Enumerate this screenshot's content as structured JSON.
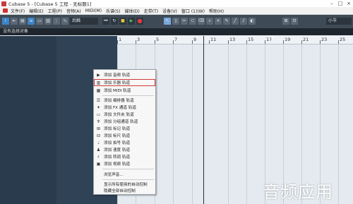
{
  "window": {
    "title": "Cubase 5 - [Cubase 5 工程 - 无标题1]",
    "controls": [
      "–",
      "□",
      "×"
    ]
  },
  "menubar": {
    "items": [
      "文件(F)",
      "编辑(E)",
      "工程(P)",
      "音频(A)",
      "MIDI(M)",
      "乐谱(S)",
      "媒体(D)",
      "走带(T)",
      "设备(V)",
      "窗口 (1)(W)",
      "帮助(H)"
    ]
  },
  "toolbar": {
    "mode_text": "后触",
    "snap_text": "小节"
  },
  "status": {
    "text": "没有选择对象"
  },
  "ruler": {
    "labels": [
      "1",
      "3",
      "5",
      "7",
      "9",
      "11",
      "13",
      "15",
      "17",
      "19",
      "21",
      "23",
      "25"
    ]
  },
  "context_menu": {
    "items": [
      {
        "label": "添加 音频 轨道",
        "icon": "play-icon"
      },
      {
        "label": "添加 乐器 轨道",
        "icon": "instrument-icon",
        "highlighted": true
      },
      {
        "label": "添加 MIDI 轨道",
        "icon": "midi-icon"
      },
      {
        "label": "添加 编排器 轨道",
        "icon": "arranger-icon"
      },
      {
        "label": "添加 FX 通道 轨道",
        "icon": "fx-icon"
      },
      {
        "label": "添加 文件夹 轨道",
        "icon": "folder-icon"
      },
      {
        "label": "添加 分组通道 轨道",
        "icon": "group-icon"
      },
      {
        "label": "添加 标记 轨道",
        "icon": "marker-icon"
      },
      {
        "label": "添加 标尺 轨道",
        "icon": "ruler-icon"
      },
      {
        "label": "添加 拍号 轨道",
        "icon": "signature-icon"
      },
      {
        "label": "添加 速度 轨道",
        "icon": "tempo-icon"
      },
      {
        "label": "添加 转调 轨道",
        "icon": "transpose-icon"
      },
      {
        "label": "添加 视频 轨道",
        "icon": "video-icon"
      },
      {
        "label": "浏览声音...",
        "icon": ""
      },
      {
        "label": "显示所有使用的自动控制",
        "icon": ""
      },
      {
        "label": "隐藏全部自动控制",
        "icon": ""
      }
    ]
  },
  "watermark": "音频应用",
  "colors": {
    "toolbar": "#3e4b57",
    "tracklist": "#2a3b4e",
    "highlight_outline": "#d23a3a"
  }
}
